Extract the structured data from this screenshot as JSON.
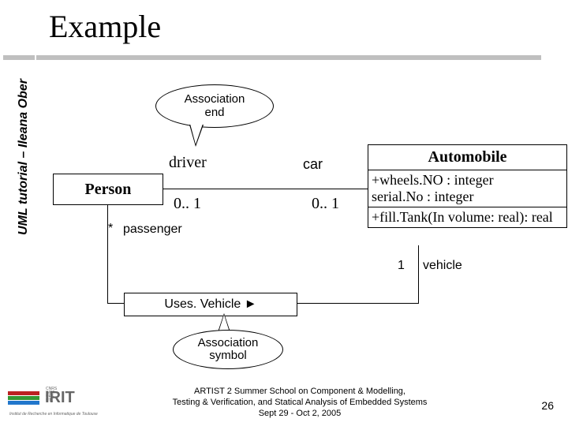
{
  "meta": {
    "side_text": "UML tutorial – Ileana Ober",
    "title": "Example",
    "slide_number": "26"
  },
  "callouts": {
    "assoc_end": "Association\nend",
    "assoc_symbol": "Association\nsymbol"
  },
  "classes": {
    "person": {
      "name": "Person"
    },
    "automobile": {
      "name": "Automobile",
      "attrs": [
        "+wheels.NO : integer",
        "serial.No : integer"
      ],
      "ops": [
        "+fill.Tank(In volume: real): real"
      ]
    }
  },
  "assoc_top": {
    "role_left": "driver",
    "role_right": "car",
    "mult_left": "0.. 1",
    "mult_right": "0.. 1"
  },
  "assoc_bottom": {
    "mult_passenger": "*",
    "role_passenger": "passenger",
    "class_name": "Uses. Vehicle ►",
    "mult_vehicle": "1",
    "role_vehicle": "vehicle"
  },
  "footer": {
    "logo_text": "IRIT",
    "logo_tags": "CNRS\nINPT\nUPS\nUT1",
    "logo_sub": "Institut de Recherche en Informatique de Toulouse",
    "lines": [
      "ARTIST 2 Summer School on Component & Modelling,",
      "Testing & Verification, and Statical Analysis of Embedded Systems",
      "Sept 29 - Oct 2, 2005"
    ]
  }
}
